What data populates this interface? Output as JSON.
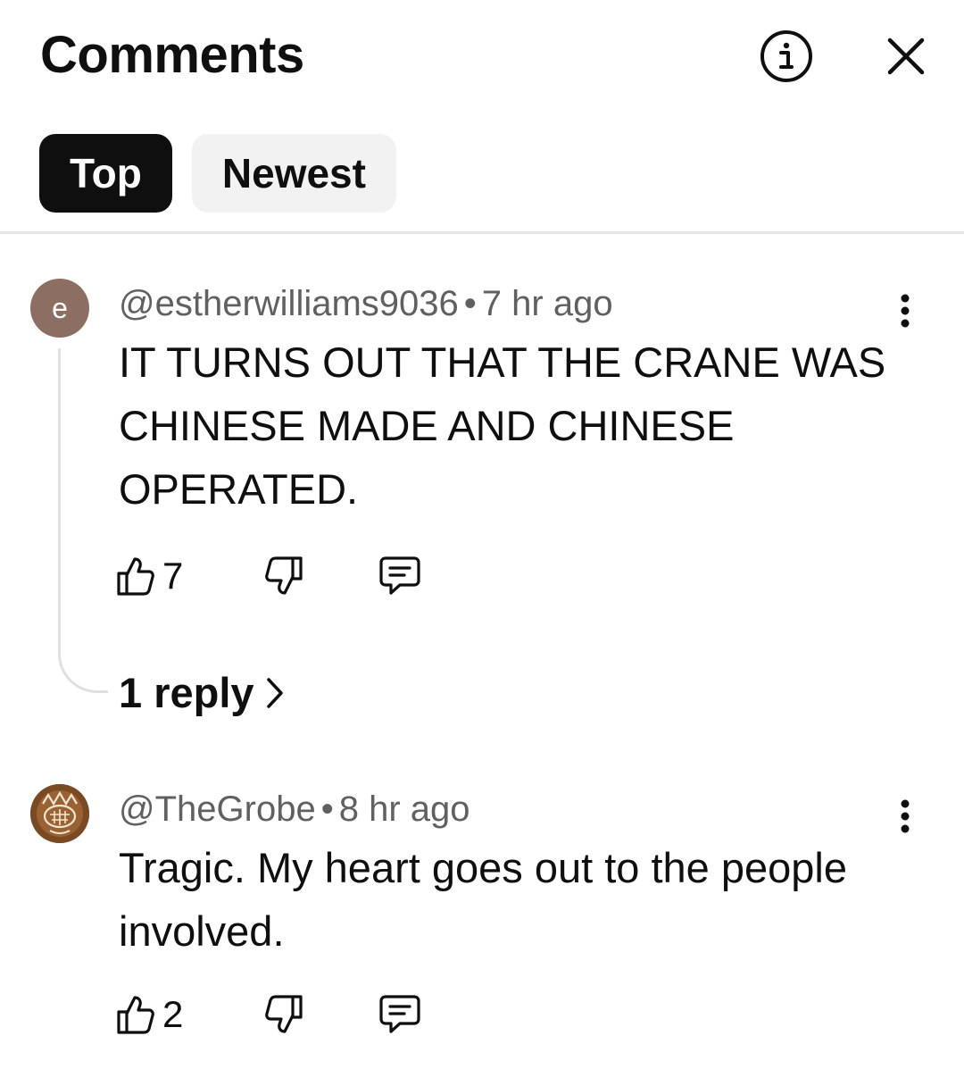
{
  "header": {
    "title": "Comments",
    "info_icon": "info-icon",
    "close_icon": "close-icon"
  },
  "sort_chips": [
    {
      "label": "Top",
      "active": true
    },
    {
      "label": "Newest",
      "active": false
    }
  ],
  "comments": [
    {
      "avatar_letter": "e",
      "avatar_color": "#8d6e63",
      "author": "@estherwilliams9036",
      "separator": "•",
      "time": "7 hr ago",
      "text": "IT TURNS OUT THAT THE CRANE WAS CHINESE MADE AND CHINESE OPERATED.",
      "likes": "7",
      "replies_label": "1 reply"
    },
    {
      "avatar_letter": "",
      "author": "@TheGrobe",
      "separator": "•",
      "time": "8 hr ago",
      "text": "Tragic.  My heart goes out to the people involved.",
      "likes": "2"
    }
  ],
  "colors": {
    "text": "#0f0f0f",
    "secondary": "#606060",
    "chip_active_bg": "#0f0f0f",
    "chip_inactive_bg": "#f2f2f2"
  }
}
